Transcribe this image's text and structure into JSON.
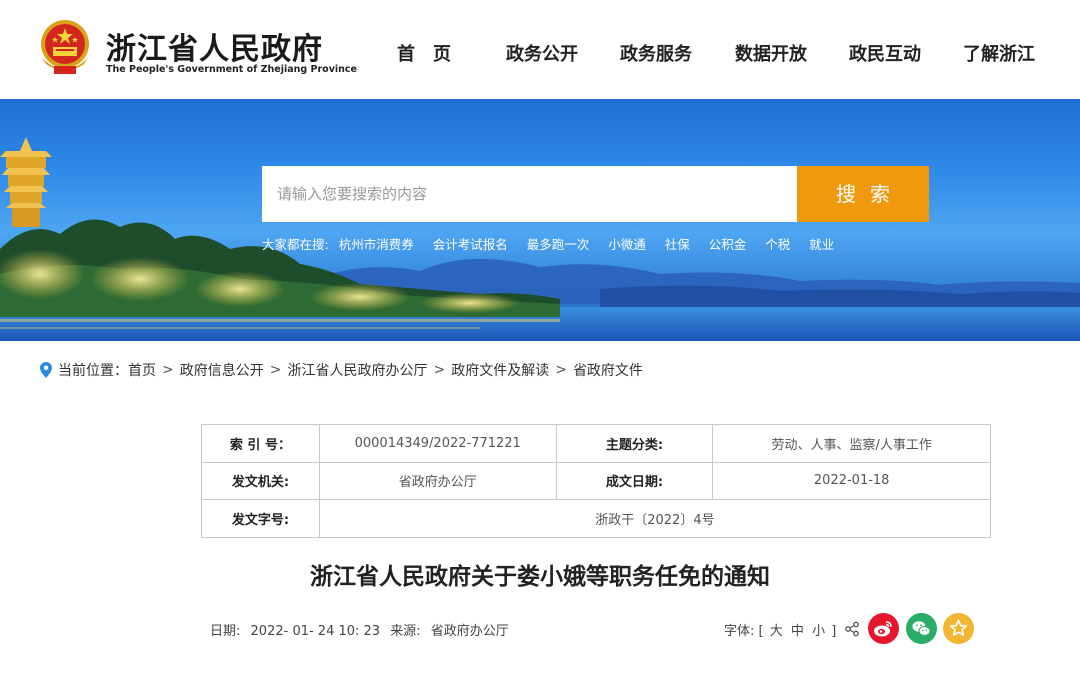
{
  "header": {
    "title": "浙江省人民政府",
    "subtitle": "The People's Government of Zhejiang Province",
    "nav": [
      "首　页",
      "政务公开",
      "政务服务",
      "数据开放",
      "政民互动",
      "了解浙江"
    ]
  },
  "search": {
    "placeholder": "请输入您要搜索的内容",
    "button": "搜索",
    "hot_label": "大家都在搜:",
    "hot_items": [
      "杭州市消费券",
      "会计考试报名",
      "最多跑一次",
      "小微通",
      "社保",
      "公积金",
      "个税",
      "就业"
    ]
  },
  "breadcrumb": {
    "label": "当前位置：",
    "items": [
      "首页",
      "政府信息公开",
      "浙江省人民政府办公厅",
      "政府文件及解读",
      "省政府文件"
    ]
  },
  "info": {
    "index_label": "索 引 号：",
    "index_value": "000014349/2022-771221",
    "topic_label": "主题分类:",
    "topic_value": "劳动、人事、监察/人事工作",
    "issuer_label": "发文机关:",
    "issuer_value": "省政府办公厅",
    "date_label": "成文日期:",
    "date_value": "2022-01-18",
    "docno_label": "发文字号:",
    "docno_value": "浙政干〔2022〕4号"
  },
  "doc": {
    "title": "浙江省人民政府关于娄小娥等职务任免的通知",
    "date_label": "日期:",
    "date_value": "2022- 01- 24 10: 23",
    "source_label": "来源:",
    "source_value": "省政府办公厅",
    "font_label": "字体:",
    "font_open": "[",
    "font_large": "大",
    "font_medium": "中",
    "font_small": "小",
    "font_close": "]"
  },
  "colors": {
    "accent": "#f0990f",
    "weibo": "#e6162d",
    "wechat": "#2aae67",
    "favorite": "#f2b632"
  }
}
